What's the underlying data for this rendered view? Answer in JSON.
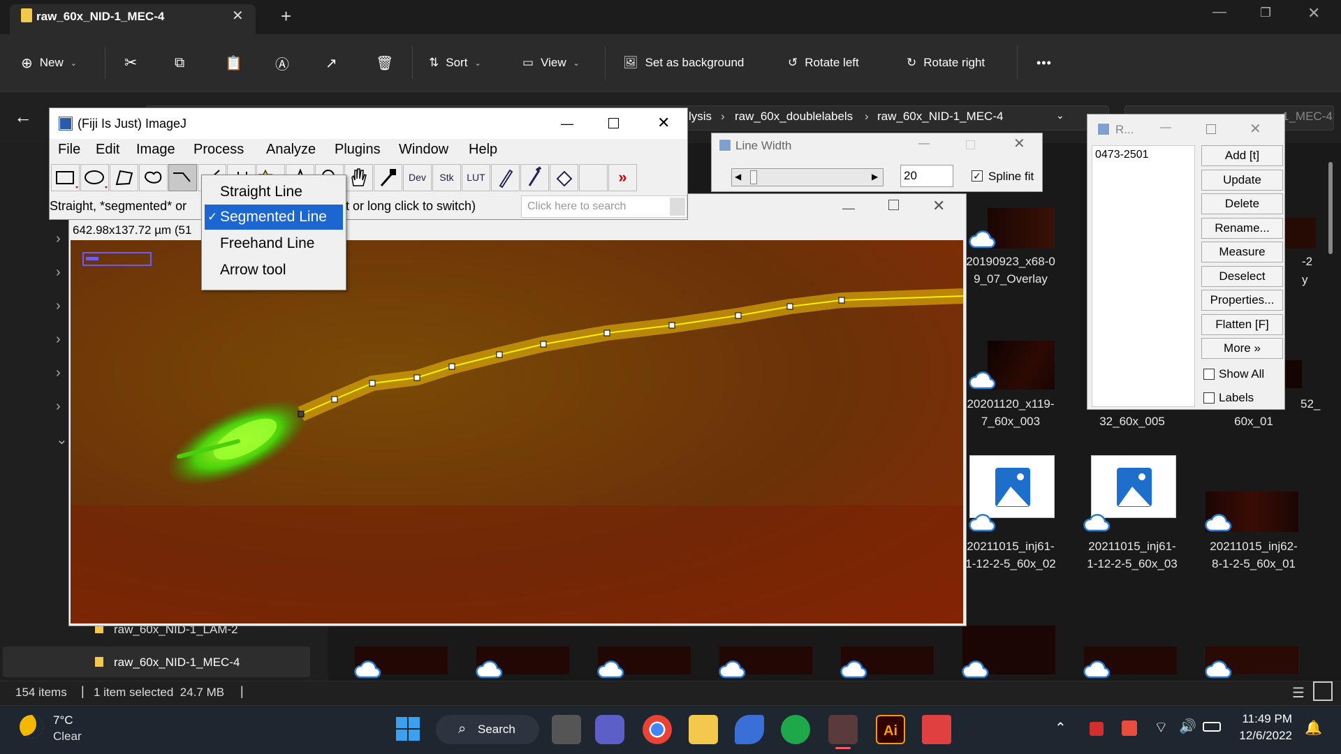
{
  "explorer": {
    "tab_title": "raw_60x_NID-1_MEC-4",
    "toolbar": {
      "new": "New",
      "sort": "Sort",
      "view": "View",
      "set_background": "Set as background",
      "rotate_left": "Rotate left",
      "rotate_right": "Rotate right",
      "more": "•••"
    },
    "breadcrumb": [
      "lysis",
      "raw_60x_doublelabels",
      "raw_60x_NID-1_MEC-4"
    ],
    "search_partial": "1_MEC-4",
    "nav_items": [
      {
        "label": "raw_60x_NID-1_LAM-2"
      },
      {
        "label": "raw_60x_NID-1_MEC-4"
      }
    ],
    "files": [
      {
        "name": "20190923_x68-0\n9_07_Overlay"
      },
      {
        "name": "20201120_x119-\n7_60x_003"
      },
      {
        "name": "32_60x_005"
      },
      {
        "name": "60x_01"
      },
      {
        "name": "-2"
      },
      {
        "name": "y"
      },
      {
        "name": "52_"
      },
      {
        "name": "20211015_inj61-\n1-12-2-5_60x_02"
      },
      {
        "name": "20211015_inj61-\n1-12-2-5_60x_03"
      },
      {
        "name": "20211015_inj62-\n8-1-2-5_60x_01"
      }
    ],
    "status": {
      "items": "154 items",
      "selected": "1 item selected  24.7 MB"
    }
  },
  "imagej": {
    "title": "(Fiji Is Just) ImageJ",
    "menus": [
      "File",
      "Edit",
      "Image",
      "Process",
      "Analyze",
      "Plugins",
      "Window",
      "Help"
    ],
    "tool_labels": {
      "dev": "Dev",
      "stk": "Stk",
      "lut": "LUT"
    },
    "status_left": "Straight, *segmented* or",
    "status_right": "s (alt or long click to switch)",
    "search_placeholder": "Click here to search"
  },
  "line_menu": {
    "items": [
      {
        "label": "Straight Line",
        "selected": false
      },
      {
        "label": "Segmented Line",
        "selected": true
      },
      {
        "label": "Freehand Line",
        "selected": false
      },
      {
        "label": "Arrow tool",
        "selected": false
      }
    ]
  },
  "image_window": {
    "info": "642.98x137.72 µm (51"
  },
  "line_width": {
    "title": "Line Width",
    "value": "20",
    "spline_label": "Spline fit",
    "spline_checked": true
  },
  "roi_manager": {
    "title": "R...",
    "list": [
      "0473-2501"
    ],
    "buttons": [
      "Add [t]",
      "Update",
      "Delete",
      "Rename...",
      "Measure",
      "Deselect",
      "Properties...",
      "Flatten [F]",
      "More »"
    ],
    "show_all": "Show All",
    "labels": "Labels"
  },
  "taskbar": {
    "weather_temp": "7°C",
    "weather_cond": "Clear",
    "search": "Search",
    "time": "11:49 PM",
    "date": "12/6/2022"
  }
}
